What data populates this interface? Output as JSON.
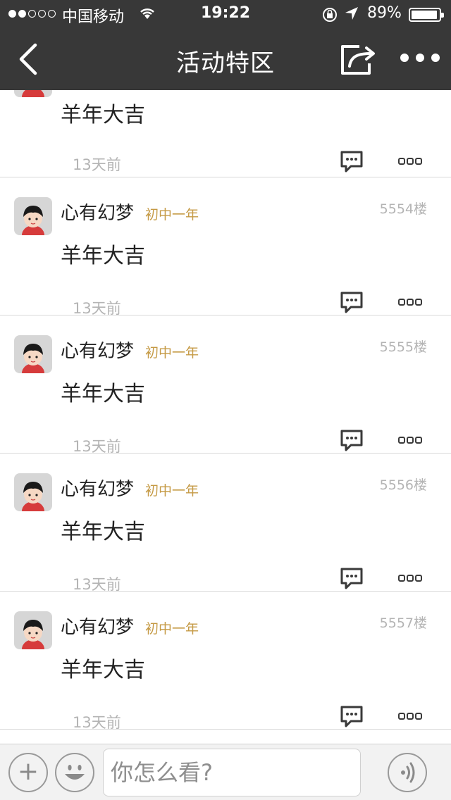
{
  "status": {
    "carrier": "中国移动",
    "time": "19:22",
    "battery": "89%"
  },
  "nav": {
    "title": "活动特区"
  },
  "posts": [
    {
      "content": "羊年大吉",
      "ago": "13天前"
    },
    {
      "name": "心有幻梦",
      "level": "初中一年",
      "floor": "5554楼",
      "content": "羊年大吉",
      "ago": "13天前"
    },
    {
      "name": "心有幻梦",
      "level": "初中一年",
      "floor": "5555楼",
      "content": "羊年大吉",
      "ago": "13天前"
    },
    {
      "name": "心有幻梦",
      "level": "初中一年",
      "floor": "5556楼",
      "content": "羊年大吉",
      "ago": "13天前"
    },
    {
      "name": "心有幻梦",
      "level": "初中一年",
      "floor": "5557楼",
      "content": "羊年大吉",
      "ago": "13天前"
    }
  ],
  "composer": {
    "placeholder": "你怎么看?",
    "plus": "+"
  }
}
